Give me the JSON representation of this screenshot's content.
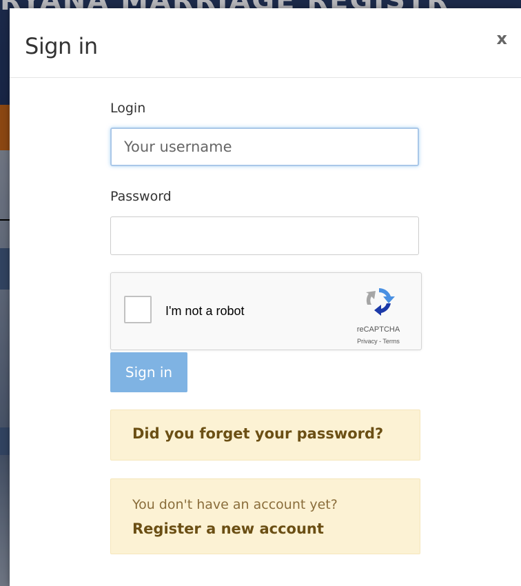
{
  "background": {
    "header_text": "RYANA MARRIAGE REGISTR"
  },
  "modal": {
    "title": "Sign in",
    "close_label": "x"
  },
  "form": {
    "login_label": "Login",
    "login_placeholder": "Your username",
    "login_value": "",
    "password_label": "Password",
    "password_value": ""
  },
  "recaptcha": {
    "label": "I'm not a robot",
    "brand": "reCAPTCHA",
    "links": "Privacy - Terms",
    "checked": false
  },
  "signin_button": {
    "label": "Sign in"
  },
  "forgot": {
    "link": "Did you forget your password?"
  },
  "register": {
    "prompt": "You don't have an account yet?",
    "link": "Register a new account"
  },
  "colors": {
    "primary_button": "#7fb3e3",
    "alert_background": "#fcf2d4",
    "alert_text": "#8a6d3b",
    "link_text": "#6b4f14",
    "focus_border": "#a9c7e8"
  }
}
